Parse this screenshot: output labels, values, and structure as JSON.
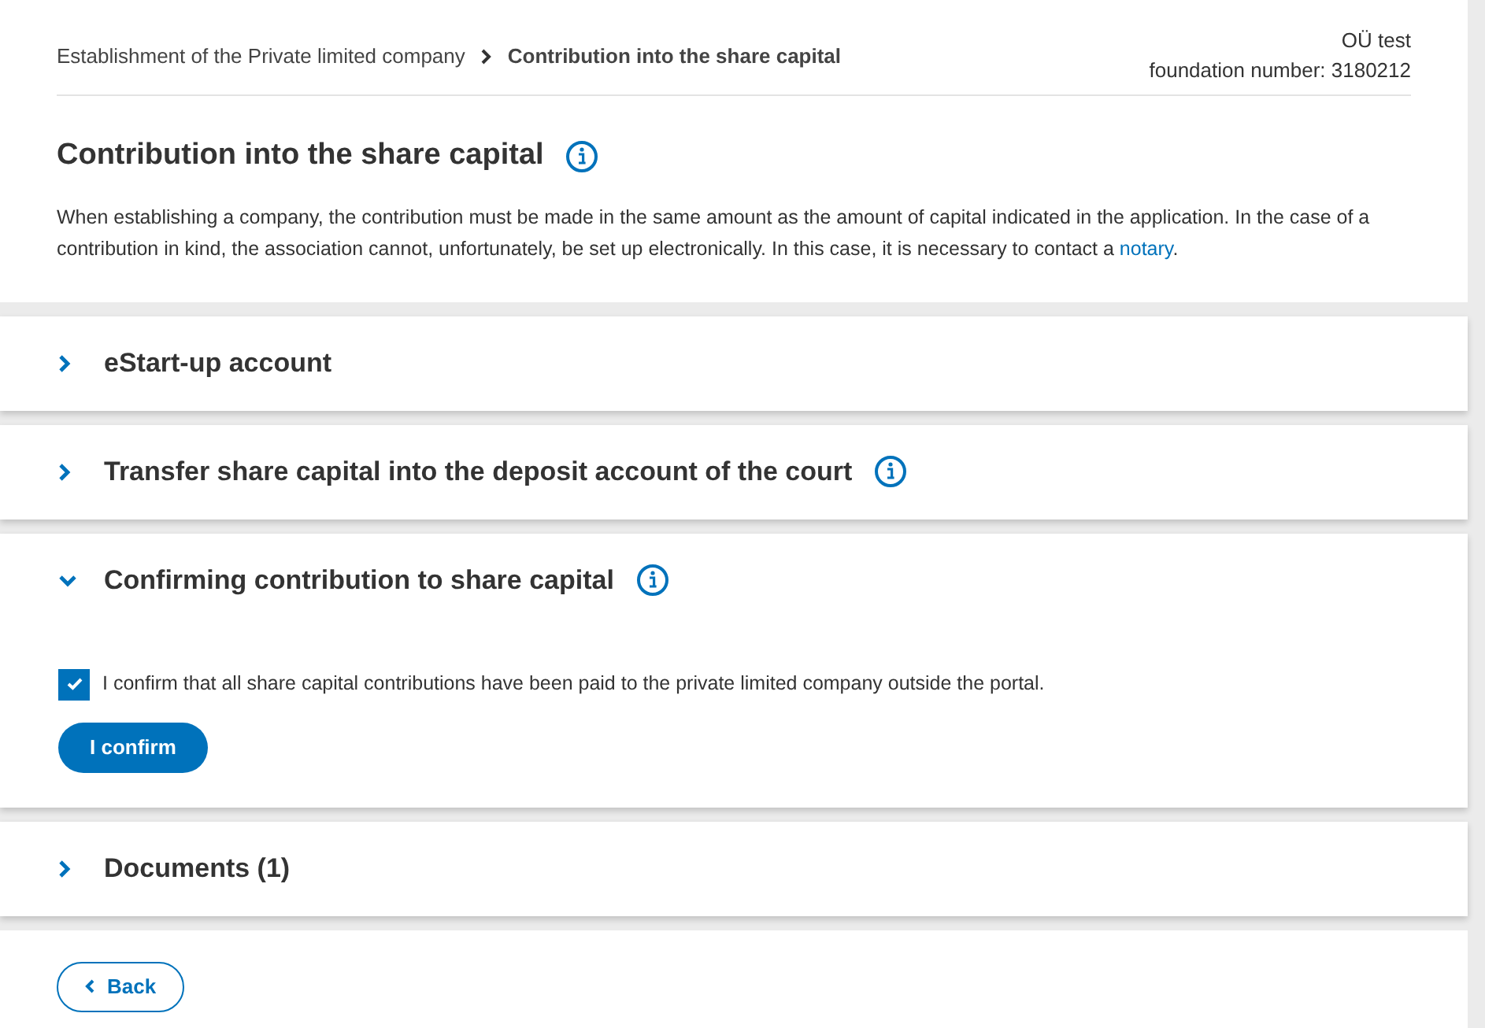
{
  "breadcrumb": [
    {
      "label": "Establishment of the Private limited company",
      "current": false
    },
    {
      "label": "Contribution into the share capital",
      "current": true
    }
  ],
  "company": {
    "name": "OÜ test",
    "foundation_number": "foundation number: 3180212"
  },
  "heading": {
    "title": "Contribution into the share capital",
    "info": true
  },
  "intro": {
    "text": "When establishing a company, the contribution must be made in the same amount as the amount of capital indicated in the application. In the case of a contribution in kind, the association cannot, unfortunately, be set up electronically. In this case, it is necessary to contact a",
    "link": "notary",
    "after": "."
  },
  "sections": [
    {
      "title": "eStart-up account",
      "info": false,
      "expanded": false
    },
    {
      "title": "Transfer share capital into the deposit account of the court",
      "info": true,
      "expanded": false
    },
    {
      "title": "Confirming contribution to share capital",
      "info": true,
      "expanded": true,
      "checkbox": {
        "label": "I confirm that all share capital contributions have been paid to the private limited company outside the portal.",
        "checked": true
      },
      "button": "I confirm"
    },
    {
      "title": "Documents (1)",
      "info": false,
      "expanded": false
    }
  ],
  "back_button": "Back"
}
